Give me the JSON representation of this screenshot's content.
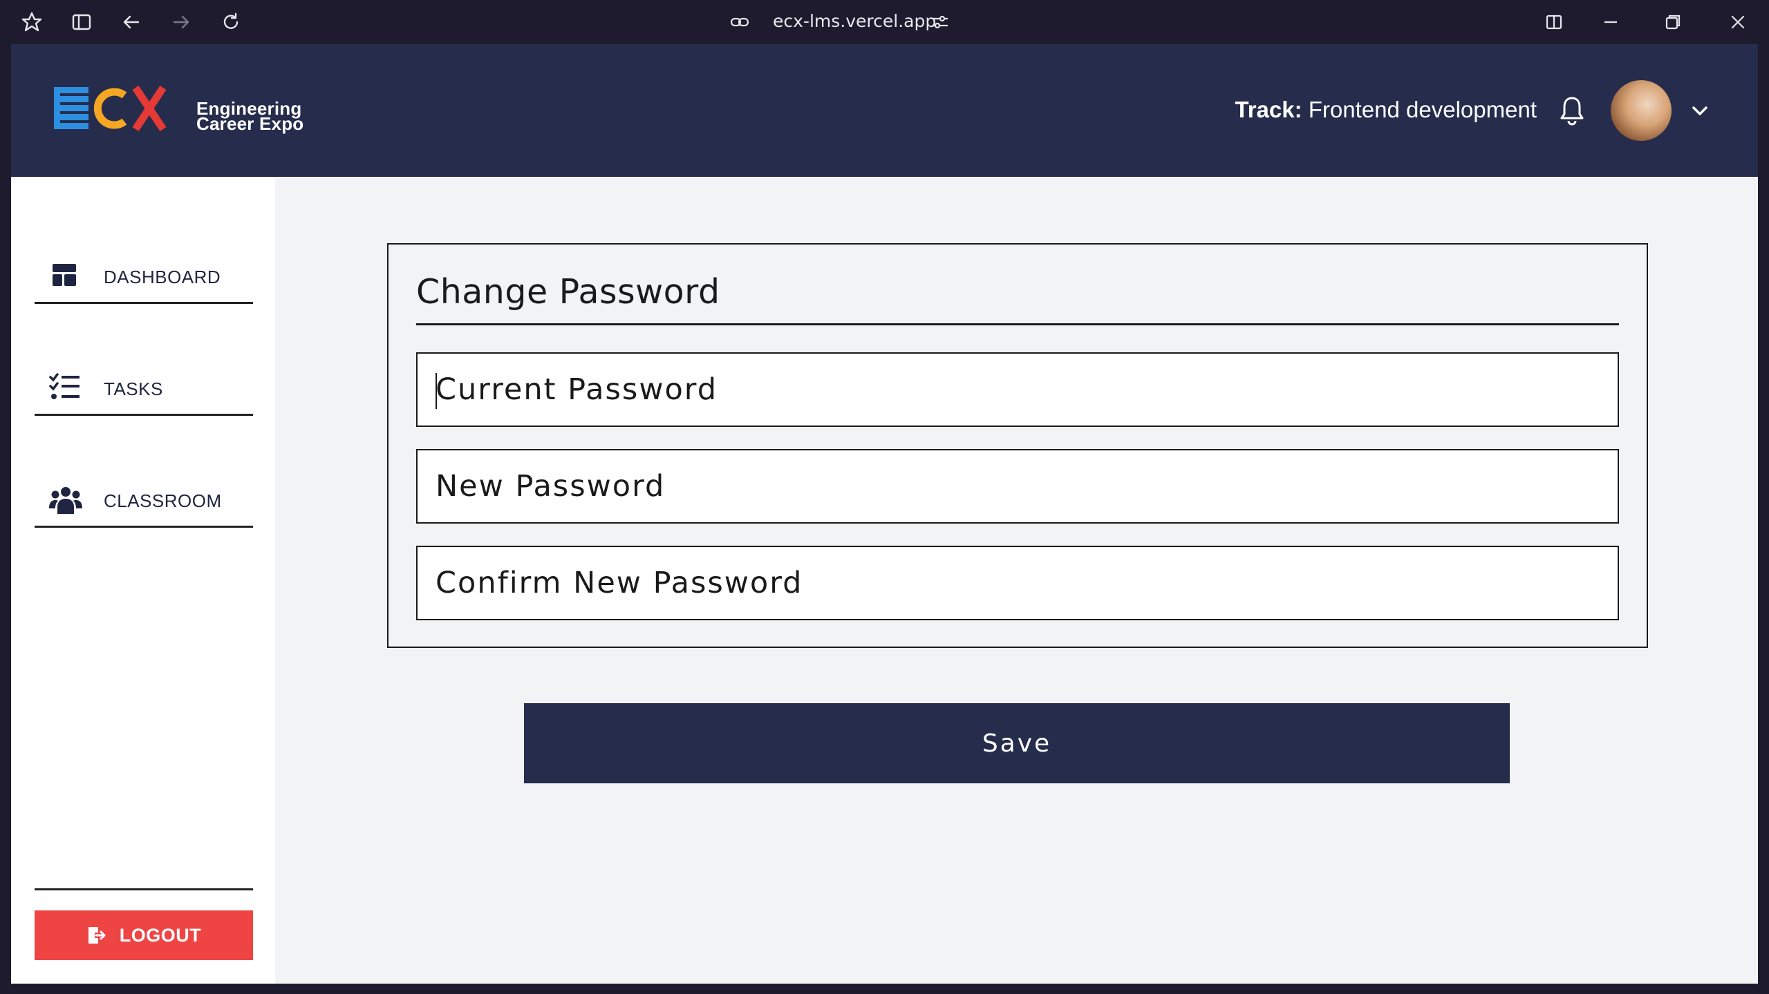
{
  "browser": {
    "url": "ecx-lms.vercel.app"
  },
  "header": {
    "logo_text": "ECX",
    "logo_subtitle_line1": "Engineering",
    "logo_subtitle_line2": "Career Expo",
    "track_label": "Track:",
    "track_value": " Frontend development",
    "bell_icon": "bell-icon",
    "avatar_icon": "user-avatar",
    "menu_icon": "chevron-down-icon"
  },
  "sidebar": {
    "items": [
      {
        "label": "DASHBOARD",
        "icon": "dashboard-icon"
      },
      {
        "label": "TASKS",
        "icon": "tasks-checklist-icon"
      },
      {
        "label": "CLASSROOM",
        "icon": "users-group-icon"
      }
    ],
    "logout_label": "LOGOUT",
    "logout_icon": "logout-icon"
  },
  "form": {
    "title": "Change Password",
    "fields": [
      {
        "placeholder": "Current Password"
      },
      {
        "placeholder": "New Password"
      },
      {
        "placeholder": "Confirm New Password"
      }
    ],
    "save_label": "Save"
  },
  "colors": {
    "header_bg": "#252c4c",
    "logout_bg": "#ef4444",
    "logo_blue": "#2d8fe0",
    "logo_orange": "#f5a623",
    "logo_red": "#e53935"
  }
}
